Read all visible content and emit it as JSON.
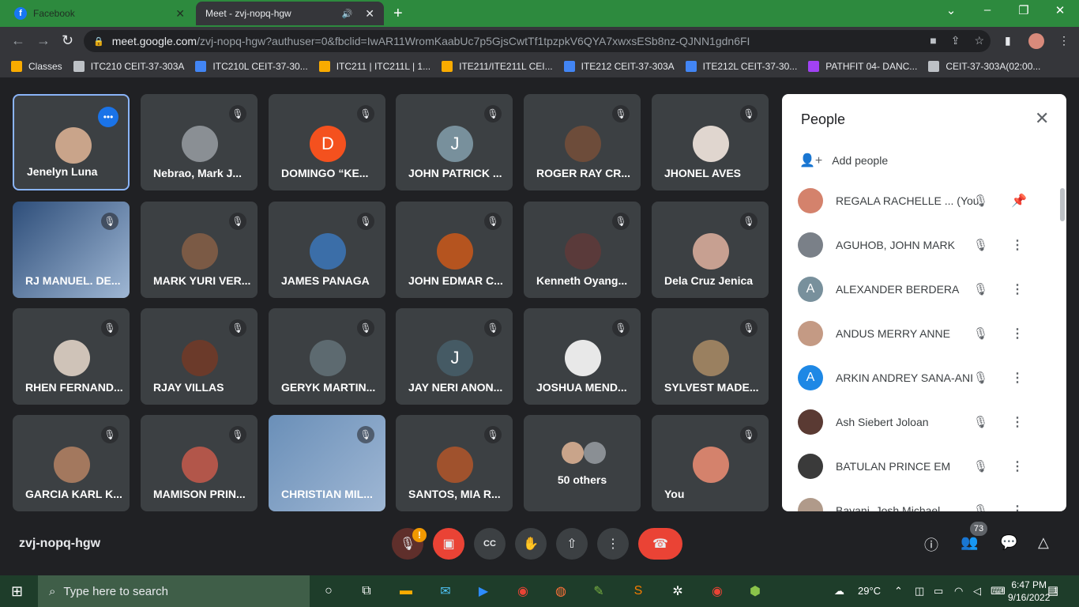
{
  "browser": {
    "tabs": [
      {
        "title": "Facebook",
        "icon": "facebook-icon"
      },
      {
        "title": "Meet - zvj-nopq-hgw",
        "icon": "meet-icon"
      }
    ],
    "url_host": "meet.google.com",
    "url_path": "/zvj-nopq-hgw?authuser=0&fbclid=IwAR11WromKaabUc7p5GjsCwtTf1tpzpkV6QYA7xwxsESb8nz-QJNN1gdn6FI",
    "bookmarks": [
      "Classes",
      "ITC210 CEIT-37-303A",
      "ITC210L CEIT-37-30...",
      "ITC211 | ITC211L | 1...",
      "ITE211/ITE211L CEI...",
      "ITE212 CEIT-37-303A",
      "ITE212L CEIT-37-30...",
      "PATHFIT 04- DANC...",
      "CEIT-37-303A(02:00..."
    ]
  },
  "meet": {
    "code": "zvj-nopq-hgw",
    "tiles": [
      {
        "name": "Jenelyn Luna",
        "initial": "",
        "color": "#c9a48a",
        "speaking": true
      },
      {
        "name": "Nebrao, Mark J...",
        "initial": "",
        "color": "#8a8f94"
      },
      {
        "name": "DOMINGO “KE...",
        "initial": "D",
        "color": "#f4511e"
      },
      {
        "name": "JOHN PATRICK ...",
        "initial": "J",
        "color": "#78909c"
      },
      {
        "name": "ROGER RAY CR...",
        "initial": "",
        "color": "#6d4c3a"
      },
      {
        "name": "JHONEL AVES",
        "initial": "",
        "color": "#e0d6cf"
      },
      {
        "name": "RJ MANUEL. DE...",
        "initial": "",
        "color": "#2e4e7a",
        "video": true
      },
      {
        "name": "MARK YURI VER...",
        "initial": "",
        "color": "#7b5a45"
      },
      {
        "name": "JAMES PANAGA",
        "initial": "",
        "color": "#3b6ea8"
      },
      {
        "name": "JOHN EDMAR C...",
        "initial": "",
        "color": "#b5541f"
      },
      {
        "name": "Kenneth Oyang...",
        "initial": "",
        "color": "#5a3a3a"
      },
      {
        "name": "Dela Cruz Jenica",
        "initial": "",
        "color": "#c7a091"
      },
      {
        "name": "RHEN FERNAND...",
        "initial": "",
        "color": "#cfc3b8"
      },
      {
        "name": "RJAY VILLAS",
        "initial": "",
        "color": "#6b3a2a"
      },
      {
        "name": "GERYK MARTIN...",
        "initial": "",
        "color": "#5d6a70"
      },
      {
        "name": "JAY NERI ANON...",
        "initial": "J",
        "color": "#455a64"
      },
      {
        "name": "JOSHUA MEND...",
        "initial": "",
        "color": "#e8e8e8"
      },
      {
        "name": "SYLVEST MADE...",
        "initial": "",
        "color": "#9a8060"
      },
      {
        "name": "GARCIA KARL K...",
        "initial": "",
        "color": "#a3785e"
      },
      {
        "name": "MAMISON PRIN...",
        "initial": "",
        "color": "#b2564a"
      },
      {
        "name": "CHRISTIAN MIL...",
        "initial": "",
        "color": "#6a8fb8",
        "video": true
      },
      {
        "name": "SANTOS, MIA R...",
        "initial": "",
        "color": "#a0522d"
      },
      {
        "name": "",
        "initial": "",
        "color": "#8d6e63",
        "others": "50 others"
      },
      {
        "name": "You",
        "initial": "",
        "color": "#d4826c",
        "speaking": false
      }
    ],
    "controls": {
      "warning_badge": "!",
      "people_count": "73"
    }
  },
  "people_panel": {
    "title": "People",
    "add_people": "Add people",
    "participants": [
      {
        "name": "REGALA RACHELLE ... (You)",
        "initial": "",
        "color": "#d4826c",
        "action": "pin"
      },
      {
        "name": "AGUHOB, JOHN MARK",
        "initial": "",
        "color": "#7a8088",
        "action": "more"
      },
      {
        "name": "ALEXANDER BERDERA",
        "initial": "A",
        "color": "#78909c",
        "action": "more"
      },
      {
        "name": "ANDUS MERRY ANNE",
        "initial": "",
        "color": "#c49a84",
        "action": "more"
      },
      {
        "name": "ARKIN ANDREY SANA-ANI",
        "initial": "A",
        "color": "#1e88e5",
        "action": "more"
      },
      {
        "name": "Ash Siebert Joloan",
        "initial": "",
        "color": "#5a3a33",
        "action": "more"
      },
      {
        "name": "BATULAN PRINCE EM",
        "initial": "",
        "color": "#3a3a3a",
        "action": "more"
      },
      {
        "name": "Bayani, Josh Michael",
        "initial": "",
        "color": "#b09a8a",
        "action": "more"
      }
    ]
  },
  "taskbar": {
    "search_placeholder": "Type here to search",
    "temperature": "29°C",
    "time": "6:47 PM",
    "date": "9/16/2022",
    "notifications": "1"
  }
}
